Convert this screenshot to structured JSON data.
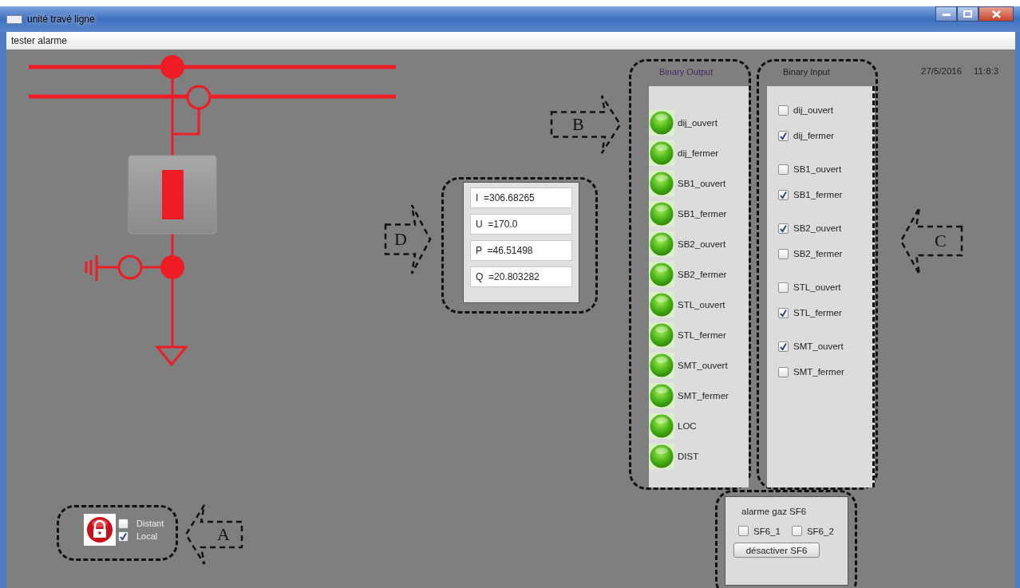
{
  "window": {
    "title": "unité travé ligne"
  },
  "menu": [
    "tester alarme"
  ],
  "datetime": {
    "date": "27/5/2016",
    "time": "11:8:3"
  },
  "measurements": [
    "I  =306.68265",
    "U  =170.0",
    "P  =46.51498",
    "Q  =20.803282"
  ],
  "binary_output": {
    "title": "Binary Output",
    "items": [
      {
        "label": "dij_ouvert",
        "on": true
      },
      {
        "label": "dij_fermer",
        "on": true
      },
      {
        "label": "SB1_ouvert",
        "on": true
      },
      {
        "label": "SB1_fermer",
        "on": true
      },
      {
        "label": "SB2_ouvert",
        "on": true
      },
      {
        "label": "SB2_fermer",
        "on": true
      },
      {
        "label": "STL_ouvert",
        "on": true
      },
      {
        "label": "STL_fermer",
        "on": true
      },
      {
        "label": "SMT_ouvert",
        "on": true
      },
      {
        "label": "SMT_fermer",
        "on": true
      },
      {
        "label": "LOC",
        "on": true
      },
      {
        "label": "DIST",
        "on": true
      }
    ]
  },
  "binary_input": {
    "title": "Binary Input",
    "items": [
      {
        "label": "dij_ouvert",
        "checked": false
      },
      {
        "label": "dij_fermer",
        "checked": true
      },
      {
        "label": "SB1_ouvert",
        "checked": false
      },
      {
        "label": "SB1_fermer",
        "checked": true
      },
      {
        "label": "SB2_ouvert",
        "checked": true
      },
      {
        "label": "SB2_fermer",
        "checked": false
      },
      {
        "label": "STL_ouvert",
        "checked": false
      },
      {
        "label": "STL_fermer",
        "checked": true
      },
      {
        "label": "SMT_ouvert",
        "checked": true
      },
      {
        "label": "SMT_fermer",
        "checked": false
      }
    ]
  },
  "mode": {
    "items": [
      {
        "label": "Distant",
        "checked": false
      },
      {
        "label": "Local",
        "checked": true
      }
    ]
  },
  "sf6": {
    "title": "alarme gaz SF6",
    "items": [
      {
        "label": "SF6_1",
        "checked": false
      },
      {
        "label": "SF6_2",
        "checked": false
      }
    ],
    "button": "désactiver SF6"
  },
  "callouts": [
    {
      "label": "A",
      "kind": "left"
    },
    {
      "label": "B",
      "kind": "right"
    },
    {
      "label": "C",
      "kind": "left"
    },
    {
      "label": "D",
      "kind": "right"
    }
  ]
}
